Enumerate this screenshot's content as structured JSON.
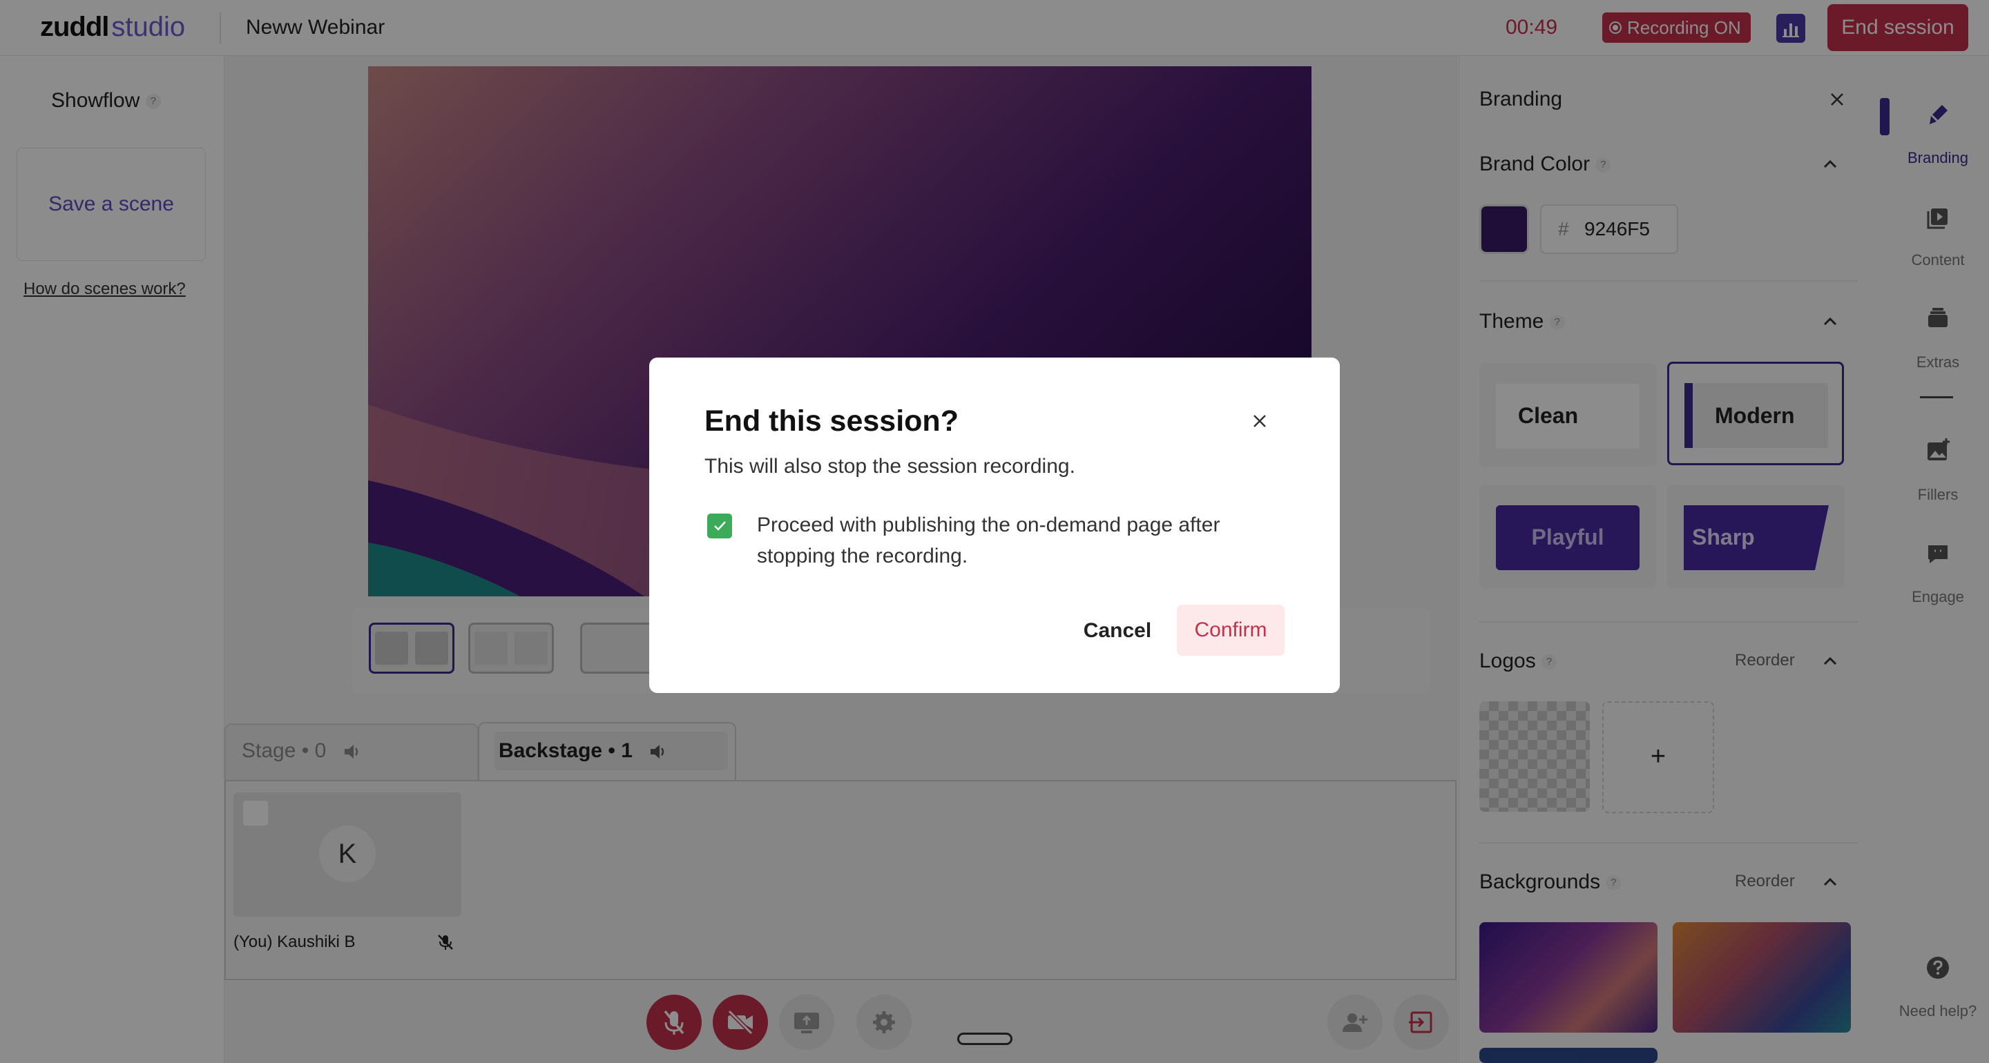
{
  "app": {
    "logo_bold": "zuddl",
    "logo_light": "studio",
    "session_title": "Neww Webinar",
    "timer": "00:49",
    "recording_label": "Recording ON",
    "end_session_label": "End session"
  },
  "left": {
    "showflow": "Showflow",
    "help_mark": "?",
    "save_scene": "Save a scene",
    "how_link": "How do scenes work?"
  },
  "stage": {
    "stage_tab": "Stage • 0",
    "backstage_tab": "Backstage • 1",
    "participant_initial": "K",
    "participant_name": "(You) Kaushiki B"
  },
  "branding": {
    "title": "Branding",
    "brand_color_title": "Brand Color",
    "hex_hash": "#",
    "hex_value": "9246F5",
    "swatch_color": "#3a1a66",
    "theme_title": "Theme",
    "themes": [
      "Clean",
      "Modern",
      "Playful",
      "Sharp"
    ],
    "selected_theme": "Modern",
    "logos_title": "Logos",
    "reorder": "Reorder",
    "add_logo": "+",
    "backgrounds_title": "Backgrounds"
  },
  "rail": {
    "items": [
      "Branding",
      "Content",
      "Extras",
      "Fillers",
      "Engage"
    ],
    "help": "Need help?"
  },
  "modal": {
    "title": "End this session?",
    "subtitle": "This will also stop the session recording.",
    "checkbox_label": "Proceed with publishing the on-demand page after stopping the recording.",
    "checkbox_checked": true,
    "cancel": "Cancel",
    "confirm": "Confirm"
  },
  "colors": {
    "accent": "#3a2a8c",
    "danger": "#c4314b",
    "check_green": "#3bab5a"
  }
}
